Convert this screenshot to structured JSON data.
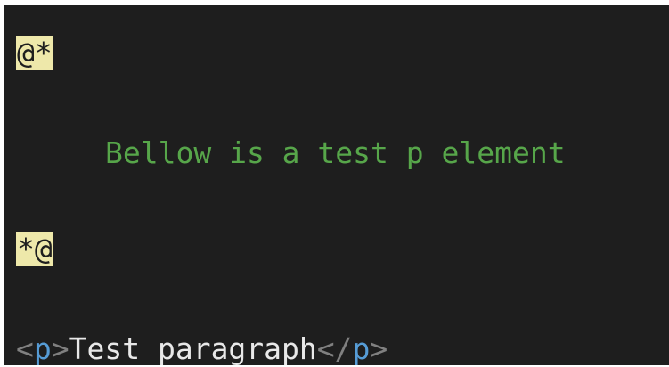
{
  "code": {
    "comment_open": "@*",
    "comment_text": "Bellow is a test p element",
    "comment_close": "*@",
    "p_open_lt": "<",
    "p_tag": "p",
    "p_open_gt": ">",
    "p_text": "Test paragraph",
    "p_close_lt": "</",
    "p_close_tag": "p",
    "p_close_gt": ">"
  },
  "colors": {
    "background": "#1e1e1e",
    "comment": "#57a64a",
    "razor_highlight": "#eee8aa",
    "tag_name": "#569cd6",
    "tag_bracket": "#808080",
    "text": "#e8e8e8"
  }
}
